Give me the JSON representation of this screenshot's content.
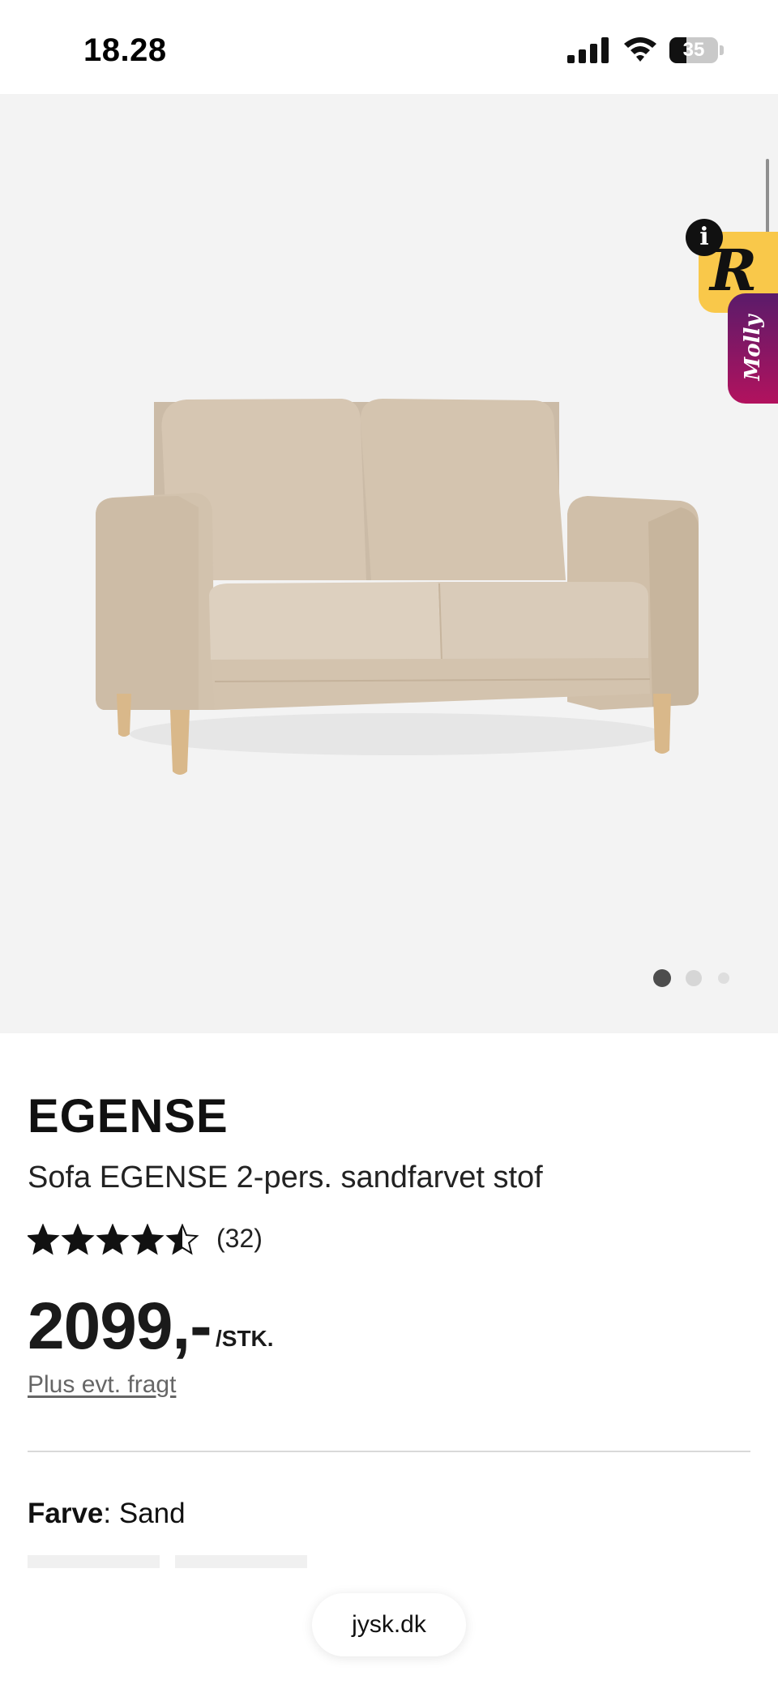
{
  "status_bar": {
    "time": "18.28",
    "battery_percent": "35",
    "battery_level": 0.35,
    "signal_icon": "cellular-signal-icon",
    "wifi_icon": "wifi-icon",
    "battery_icon": "battery-icon"
  },
  "gallery": {
    "image_count": 3,
    "active_index": 0
  },
  "widgets": {
    "r_letter": "R",
    "info_symbol": "i",
    "molly_label": "Molly"
  },
  "product": {
    "brand": "EGENSE",
    "title": "Sofa EGENSE 2-pers. sandfarvet stof",
    "rating": 4.5,
    "rating_max": 5,
    "review_count": "(32)",
    "price": "2099,-",
    "price_unit": "/STK.",
    "shipping_note": "Plus evt. fragt"
  },
  "color": {
    "label": "Farve",
    "separator": ": ",
    "value": "Sand"
  },
  "browser": {
    "url": "jysk.dk"
  },
  "colors": {
    "gallery_bg": "#f3f3f3",
    "sofa_fabric": "#d8c8b5",
    "sofa_legs": "#d9b88a",
    "widget_yellow": "#f9c84a",
    "molly_gradient_top": "#5a1b6a",
    "molly_gradient_bottom": "#b2125e"
  }
}
